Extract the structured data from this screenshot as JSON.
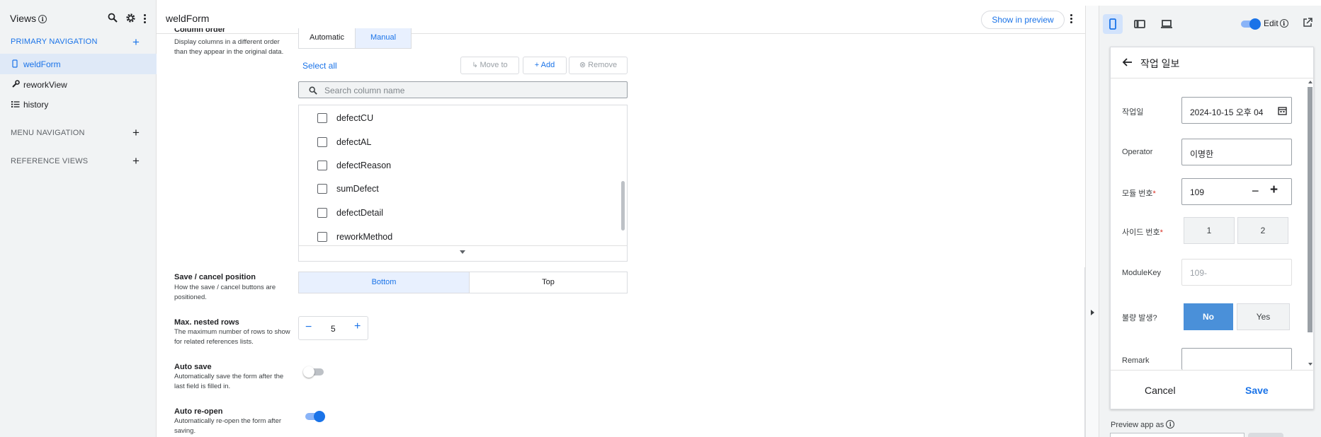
{
  "sidebar": {
    "title": "Views",
    "primary_label": "PRIMARY NAVIGATION",
    "items": [
      {
        "label": "weldForm"
      },
      {
        "label": "reworkView"
      },
      {
        "label": "history"
      }
    ],
    "menu_label": "MENU NAVIGATION",
    "reference_label": "REFERENCE VIEWS"
  },
  "topbar": {
    "title": "weldForm",
    "show_preview": "Show in preview"
  },
  "column_order": {
    "title": "Column order",
    "desc": "Display columns in a different order than they appear in the original data.",
    "seg_automatic": "Automatic",
    "seg_manual": "Manual",
    "select_all": "Select all",
    "move_to": "Move to",
    "add": "Add",
    "remove": "Remove",
    "search_placeholder": "Search column name",
    "columns": [
      "defectCU",
      "defectAL",
      "defectReason",
      "sumDefect",
      "defectDetail",
      "reworkMethod"
    ]
  },
  "save_cancel": {
    "title": "Save / cancel position",
    "desc": "How the save / cancel buttons are positioned.",
    "bottom": "Bottom",
    "top": "Top"
  },
  "max_nested": {
    "title": "Max. nested rows",
    "desc": "The maximum number of rows to show for related references lists.",
    "value": "5"
  },
  "auto_save": {
    "title": "Auto save",
    "desc": "Automatically save the form after the last field is filled in.",
    "on": false
  },
  "auto_reopen": {
    "title": "Auto re-open",
    "desc": "Automatically re-open the form after saving.",
    "on": true
  },
  "preview": {
    "edit_label": "Edit",
    "form_title": "작업 일보",
    "fields": {
      "date_label": "작업일",
      "date_value": "2024-10-15 오후 04",
      "operator_label": "Operator",
      "operator_value": "이명한",
      "module_label": "모듈 번호",
      "module_value": "109",
      "side_label": "사이드 번호",
      "side_options": [
        "1",
        "2"
      ],
      "modulekey_label": "ModuleKey",
      "modulekey_value": "109-",
      "defect_label": "불량 발생?",
      "defect_options": [
        "No",
        "Yes"
      ],
      "remark_label": "Remark"
    },
    "cancel": "Cancel",
    "save": "Save",
    "preview_as": "Preview app as"
  },
  "colors": {
    "accent": "#1a73e8",
    "selected_choice": "#4a90d9",
    "sidebar_bg": "#f1f3f4"
  }
}
